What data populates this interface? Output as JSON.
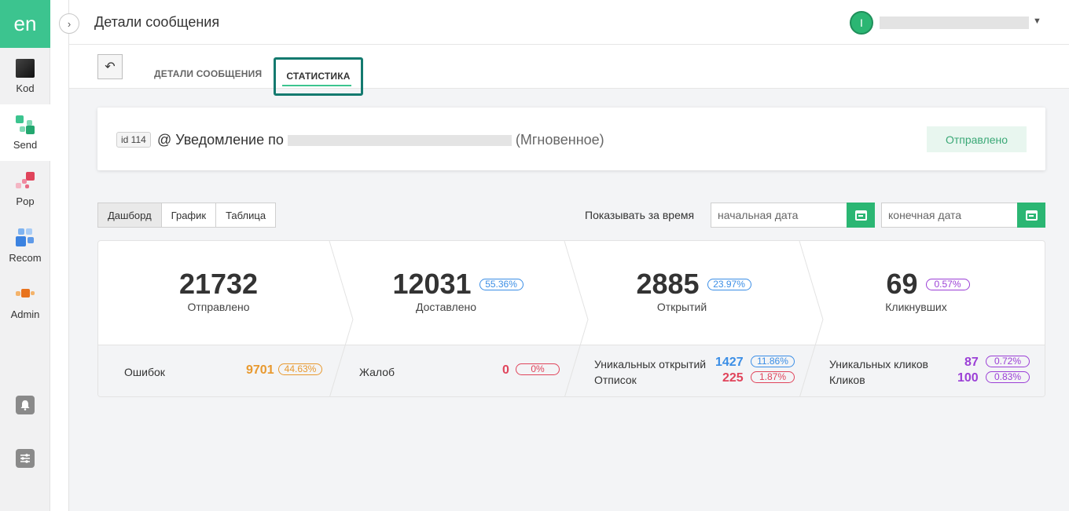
{
  "logo": "en",
  "nav": [
    {
      "label": "Kod",
      "icon": "square-dark-icon"
    },
    {
      "label": "Send",
      "icon": "send-squares-icon"
    },
    {
      "label": "Pop",
      "icon": "pop-squares-icon"
    },
    {
      "label": "Recom",
      "icon": "recom-squares-icon"
    },
    {
      "label": "Admin",
      "icon": "admin-squares-icon"
    }
  ],
  "header": {
    "title": "Детали сообщения",
    "avatar_initial": "I"
  },
  "tabs": {
    "details": "ДЕТАЛИ СООБЩЕНИЯ",
    "stats": "СТАТИСТИКА"
  },
  "message": {
    "id": "id 114",
    "title_prefix": "@ Уведомление по",
    "type": "(Мгновенное)",
    "status": "Отправлено"
  },
  "views": [
    "Дашборд",
    "График",
    "Таблица"
  ],
  "period": {
    "label": "Показывать за время",
    "start_placeholder": "начальная дата",
    "end_placeholder": "конечная дата"
  },
  "stats": {
    "sent": {
      "value": "21732",
      "label": "Отправлено"
    },
    "delivered": {
      "value": "12031",
      "pct": "55.36%",
      "label": "Доставлено"
    },
    "opens": {
      "value": "2885",
      "pct": "23.97%",
      "label": "Открытий"
    },
    "clicked": {
      "value": "69",
      "pct": "0.57%",
      "label": "Кликнувших"
    },
    "errors": {
      "label": "Ошибок",
      "value": "9701",
      "pct": "44.63%"
    },
    "complaints": {
      "label": "Жалоб",
      "value": "0",
      "pct": "0%"
    },
    "unique_opens": {
      "label": "Уникальных открытий",
      "value": "1427",
      "pct": "11.86%"
    },
    "unsubscribes": {
      "label": "Отписок",
      "value": "225",
      "pct": "1.87%"
    },
    "unique_clicks": {
      "label": "Уникальных кликов",
      "value": "87",
      "pct": "0.72%"
    },
    "clicks": {
      "label": "Кликов",
      "value": "100",
      "pct": "0.83%"
    }
  }
}
